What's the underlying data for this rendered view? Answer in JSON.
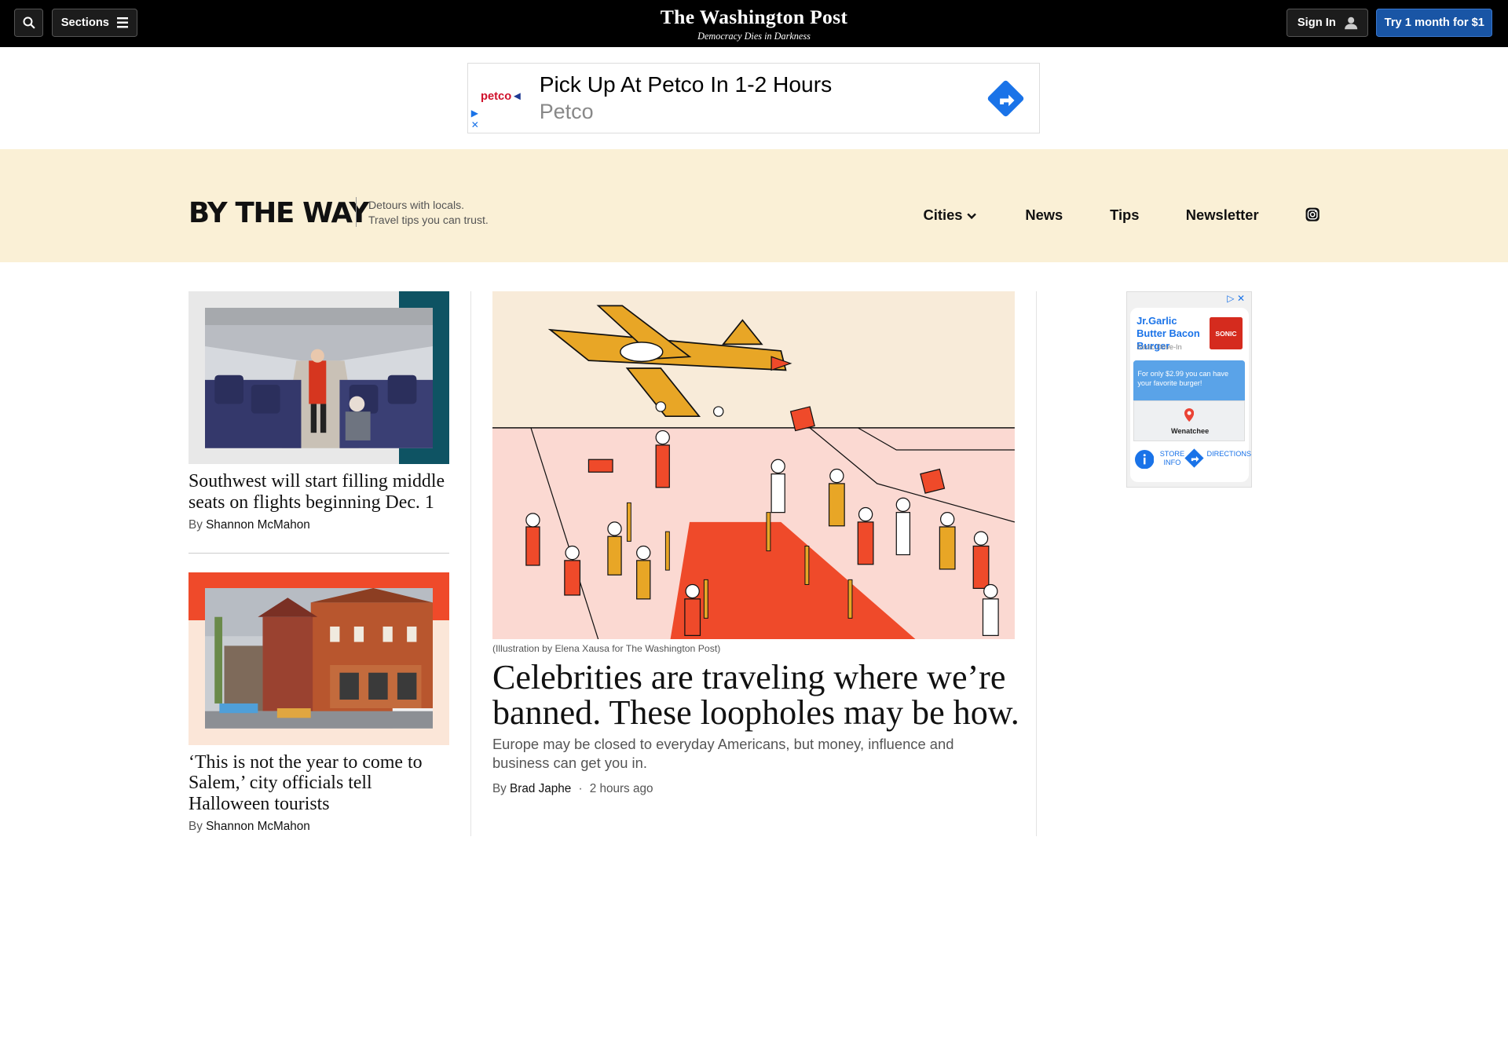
{
  "header": {
    "sections_label": "Sections",
    "logo": "The Washington Post",
    "motto": "Democracy Dies in Darkness",
    "signin_label": "Sign In",
    "trial_label": "Try 1 month for $1"
  },
  "ad_top": {
    "logo_text": "petco",
    "headline": "Pick Up At Petco In 1-2 Hours",
    "brand": "Petco"
  },
  "section": {
    "logo": "BY THE WAY",
    "tagline_1": "Detours with locals.",
    "tagline_2": "Travel tips you can trust.",
    "nav": [
      "Cities",
      "News",
      "Tips",
      "Newsletter"
    ]
  },
  "stories_left": [
    {
      "title": "Southwest will start filling middle seats on flights beginning Dec. 1",
      "by": "By",
      "author": "Shannon McMahon"
    },
    {
      "title": "‘This is not the year to come to Salem,’ city officials tell Halloween tourists",
      "by": "By",
      "author": "Shannon McMahon"
    }
  ],
  "main_story": {
    "caption": "(Illustration by Elena Xausa for The Washington Post)",
    "title": "Celebrities are traveling where we’re banned. These loopholes may be how.",
    "dek": "Europe may be closed to everyday Americans, but money, influence and business can get you in.",
    "by": "By",
    "author": "Brad Japhe",
    "separator": "·",
    "time": "2 hours ago"
  },
  "ad_right": {
    "title": "Jr.Garlic Butter Bacon Burger",
    "source": "Sonic Drive-In",
    "logo_text": "SONIC",
    "promo": "For only $2.99 you can have your favorite burger!",
    "map_city": "Wenatchee",
    "action_1": "STORE INFO",
    "action_2": "DIRECTIONS"
  },
  "colors": {
    "topbar": "#000000",
    "trial_button": "#1955a5",
    "section_band": "#faf0d6",
    "hero_red": "#ef4a2a",
    "hero_gold": "#e8a626"
  }
}
